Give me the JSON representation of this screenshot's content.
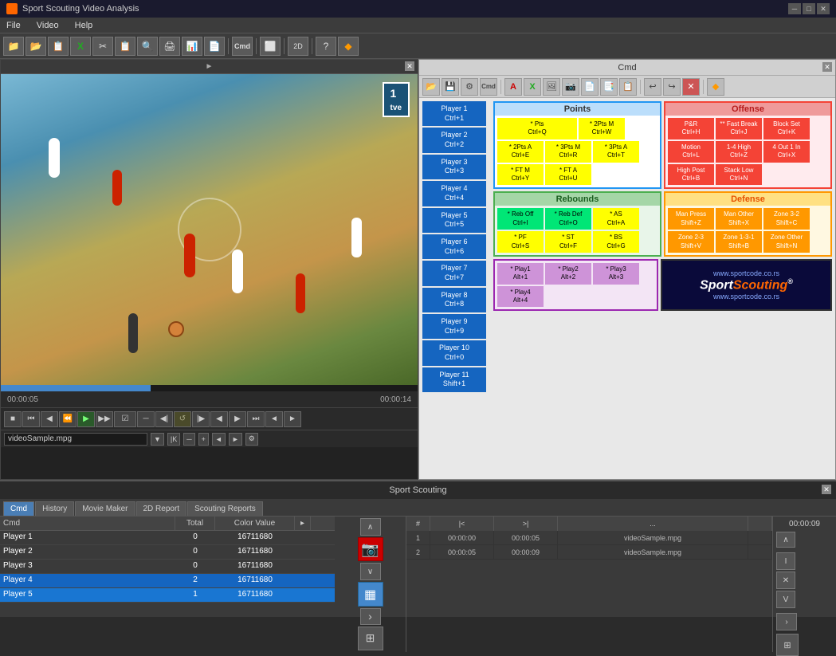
{
  "app": {
    "title": "Sport Scouting Video Analysis",
    "menus": [
      "File",
      "Video",
      "Help"
    ]
  },
  "video_panel": {
    "title": "►",
    "time_elapsed": "00:00:05",
    "time_total": "00:00:14",
    "filename": "videoSample.mpg"
  },
  "cmd_panel": {
    "title": "Cmd",
    "players": [
      {
        "label": "Player 1",
        "shortcut": "Ctrl+1"
      },
      {
        "label": "Player 2",
        "shortcut": "Ctrl+2"
      },
      {
        "label": "Player 3",
        "shortcut": "Ctrl+3"
      },
      {
        "label": "Player 4",
        "shortcut": "Ctrl+4"
      },
      {
        "label": "Player 5",
        "shortcut": "Ctrl+5"
      },
      {
        "label": "Player 6",
        "shortcut": "Ctrl+6"
      },
      {
        "label": "Player 7",
        "shortcut": "Ctrl+7"
      },
      {
        "label": "Player 8",
        "shortcut": "Ctrl+8"
      },
      {
        "label": "Player 9",
        "shortcut": "Ctrl+9"
      },
      {
        "label": "Player 10",
        "shortcut": "Ctrl+0"
      },
      {
        "label": "Player 11",
        "shortcut": "Shift+1"
      }
    ],
    "points": {
      "title": "Points",
      "buttons": [
        {
          "label": "* Pts",
          "shortcut": "Ctrl+Q"
        },
        {
          "label": "* 2Pts M",
          "shortcut": "Ctrl+W"
        },
        {
          "label": "* 2Pts A",
          "shortcut": "Ctrl+E"
        },
        {
          "label": "* 3Pts M",
          "shortcut": "Ctrl+R"
        },
        {
          "label": "* 3Pts A",
          "shortcut": "Ctrl+T"
        },
        {
          "label": "* FT M",
          "shortcut": "Ctrl+Y"
        },
        {
          "label": "* FT A",
          "shortcut": "Ctrl+U"
        }
      ]
    },
    "rebounds": {
      "title": "Rebounds",
      "buttons": [
        {
          "label": "* Reb Off",
          "shortcut": "Ctrl+I"
        },
        {
          "label": "* Reb Def",
          "shortcut": "Ctrl+O"
        },
        {
          "label": "* AS",
          "shortcut": "Ctrl+A"
        },
        {
          "label": "* PF",
          "shortcut": "Ctrl+S"
        },
        {
          "label": "* ST",
          "shortcut": "Ctrl+F"
        },
        {
          "label": "* BS",
          "shortcut": "Ctrl+G"
        }
      ]
    },
    "offense": {
      "title": "Offense",
      "buttons": [
        {
          "label": "P&R",
          "shortcut": "Ctrl+H"
        },
        {
          "label": "** Fast Break",
          "shortcut": "Ctrl+J"
        },
        {
          "label": "Block Set",
          "shortcut": "Ctrl+K"
        },
        {
          "label": "Motion",
          "shortcut": "Ctrl+L"
        },
        {
          "label": "1-4 High",
          "shortcut": "Ctrl+Z"
        },
        {
          "label": "4 Out 1 In",
          "shortcut": "Ctrl+X"
        },
        {
          "label": "High Post",
          "shortcut": "Ctrl+B"
        },
        {
          "label": "Stack Low",
          "shortcut": "Ctrl+N"
        }
      ]
    },
    "defense": {
      "title": "Defense",
      "buttons": [
        {
          "label": "Man Press",
          "shortcut": "Shift+Z"
        },
        {
          "label": "Man Other",
          "shortcut": "Shift+X"
        },
        {
          "label": "Zone 3-2",
          "shortcut": "Shift+C"
        },
        {
          "label": "Zone 2-3",
          "shortcut": "Shift+V"
        },
        {
          "label": "Zone 1-3-1",
          "shortcut": "Shift+B"
        },
        {
          "label": "Zone Other",
          "shortcut": "Shift+N"
        }
      ]
    },
    "play": {
      "buttons": [
        {
          "label": "* Play1",
          "shortcut": "Alt+1"
        },
        {
          "label": "* Play2",
          "shortcut": "Alt+2"
        },
        {
          "label": "* Play3",
          "shortcut": "Alt+3"
        },
        {
          "label": "* Play4",
          "shortcut": "Alt+4"
        }
      ]
    },
    "logo": {
      "url_top": "www.sportcode.co.rs",
      "name": "SportScouting",
      "url_bottom": "www.sportcode.co.rs"
    }
  },
  "bottom_panel": {
    "title": "Sport Scouting",
    "tabs": [
      "Cmd",
      "History",
      "Movie Maker",
      "2D Report",
      "Scouting Reports"
    ],
    "active_tab": "Cmd",
    "table": {
      "headers": [
        "Cmd",
        "Total",
        "Color Value",
        ""
      ],
      "rows": [
        {
          "cmd": "Player 1",
          "total": "0",
          "color": "16711680",
          "selected": false
        },
        {
          "cmd": "Player 2",
          "total": "0",
          "color": "16711680",
          "selected": false
        },
        {
          "cmd": "Player 3",
          "total": "0",
          "color": "16711680",
          "selected": false
        },
        {
          "cmd": "Player 4",
          "total": "2",
          "color": "16711680",
          "selected": true
        },
        {
          "cmd": "Player 5",
          "total": "1",
          "color": "16711680",
          "selected": false
        }
      ]
    },
    "right_data": {
      "headers": [
        "#",
        "|<",
        ">|",
        "...",
        ""
      ],
      "rows": [
        {
          "num": "1",
          "start": "00:00:00",
          "end": "00:00:05",
          "file": "videoSample.mpg"
        },
        {
          "num": "2",
          "start": "00:00:05",
          "end": "00:00:09",
          "file": "videoSample.mpg"
        }
      ],
      "time": "00:00:09"
    }
  }
}
